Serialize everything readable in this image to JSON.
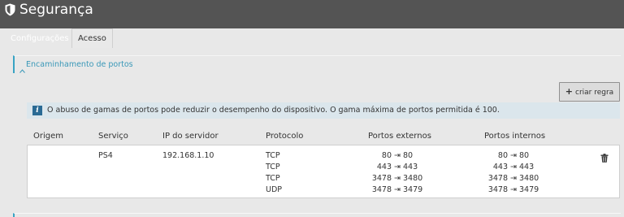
{
  "app": {
    "title": "Segurança"
  },
  "tabs": [
    {
      "label": "Configurações"
    },
    {
      "label": "Acesso"
    }
  ],
  "section": {
    "title": "Encaminhamento de portos"
  },
  "actions": {
    "create_rule": "criar regra"
  },
  "info": {
    "message": "O abuso de gamas de portos pode reduzir o desempenho do dispositivo. O gama máxima de portos permitida é 100."
  },
  "table": {
    "columns": [
      "Origem",
      "Serviço",
      "IP do servidor",
      "Protocolo",
      "Portos externos",
      "Portos internos"
    ],
    "row": {
      "origin": "",
      "service": "PS4",
      "server_ip": "192.168.1.10",
      "rules": [
        {
          "protocol": "TCP",
          "external": "80 ⇥ 80",
          "internal": "80 ⇥ 80"
        },
        {
          "protocol": "TCP",
          "external": "443 ⇥ 443",
          "internal": "443 ⇥ 443"
        },
        {
          "protocol": "TCP",
          "external": "3478 ⇥ 3480",
          "internal": "3478 ⇥ 3480"
        },
        {
          "protocol": "UDP",
          "external": "3478 ⇥ 3479",
          "internal": "3478 ⇥ 3479"
        }
      ]
    }
  },
  "icons": {
    "title": "shield-icon",
    "section": "chevron-up-icon",
    "create": "plus-icon",
    "info": "info-icon",
    "delete": "trash-icon"
  },
  "colors": {
    "accent": "#38a3c4",
    "header_bg": "#545454",
    "info_bg": "#dbe6ec"
  }
}
